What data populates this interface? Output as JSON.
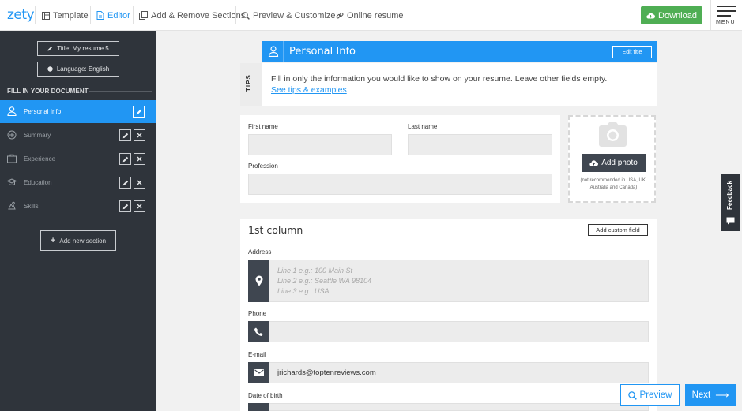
{
  "topbar": {
    "logo": "zety",
    "nav": [
      {
        "label": "Template",
        "icon": "template-icon"
      },
      {
        "label": "Editor",
        "icon": "editor-icon"
      },
      {
        "label": "Add & Remove Sections",
        "icon": "sections-icon"
      },
      {
        "label": "Preview & Customize",
        "icon": "search-icon"
      },
      {
        "label": "Online resume",
        "icon": "link-icon"
      }
    ],
    "download_label": "Download",
    "menu_label": "MENU"
  },
  "sidebar": {
    "title_button": "Title: My resume 5",
    "language_button": "Language: English",
    "fill_label": "FILL IN YOUR DOCUMENT",
    "items": [
      {
        "label": "Personal Info",
        "icon": "user-icon",
        "active": true
      },
      {
        "label": "Summary",
        "icon": "summary-icon",
        "active": false
      },
      {
        "label": "Experience",
        "icon": "briefcase-icon",
        "active": false
      },
      {
        "label": "Education",
        "icon": "graduation-cap-icon",
        "active": false
      },
      {
        "label": "Skills",
        "icon": "skills-icon",
        "active": false
      }
    ],
    "add_section": "Add new section"
  },
  "main": {
    "section_title": "Personal Info",
    "edit_title": "Edit title",
    "tips_label": "TIPS",
    "tips_text": "Fill in only the information you would like to show on your resume. Leave other fields empty.",
    "tips_link": "See tips & examples",
    "first_name_label": "First name",
    "last_name_label": "Last name",
    "profession_label": "Profession",
    "add_photo": "Add photo",
    "photo_note": "(not recommended in USA, UK, Australia and Canada)",
    "column_title": "1st column",
    "custom_field": "Add custom field",
    "address_label": "Address",
    "address_placeholder_1": "Line 1 e.g.: 100 Main St",
    "address_placeholder_2": "Line 2 e.g.: Seattle WA 98104",
    "address_placeholder_3": "Line 3 e.g.: USA",
    "phone_label": "Phone",
    "email_label": "E-mail",
    "email_value": "jrichards@toptenreviews.com",
    "dob_label": "Date of birth"
  },
  "feedback_label": "Feedback",
  "footer": {
    "preview_label": "Preview",
    "next_label": "Next"
  },
  "colors": {
    "accent": "#2196f3",
    "sidebar_bg": "#2f343b",
    "download_green": "#4fae54"
  }
}
